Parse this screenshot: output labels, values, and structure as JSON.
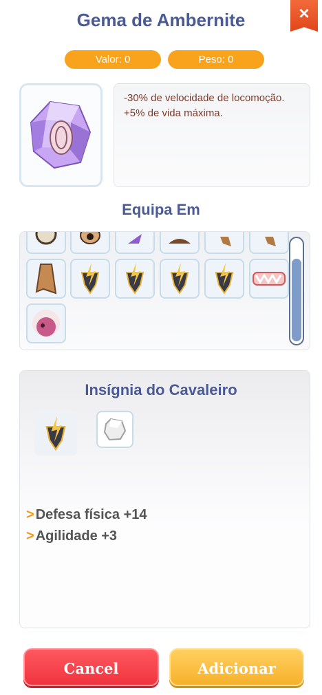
{
  "header": {
    "title": "Gema de Ambernite",
    "close_label": "×"
  },
  "stats": {
    "valor": "Valor: 0",
    "peso": "Peso: 0"
  },
  "item": {
    "icon": "amethyst-gem-icon",
    "description": "-30% de velocidade de locomoção. +5% de vida máxima."
  },
  "equipa": {
    "title": "Equipa Em",
    "items": [
      "helmet-icon",
      "mask-icon",
      "purple-boot-icon",
      "hair-icon",
      "cape-icon",
      "cape-icon",
      "cape-icon",
      "knight-insignia-icon",
      "knight-insignia-icon",
      "knight-insignia-icon",
      "knight-insignia-icon",
      "fang-mouth-icon",
      "fluffy-pet-icon"
    ]
  },
  "bonus": {
    "title": "Insígnia do Cavaleiro",
    "main_icon": "knight-insignia-icon",
    "gem_icon": "white-gem-icon",
    "lines": [
      "Defesa física +14",
      "Agilidade +3"
    ],
    "arrow": ">"
  },
  "buttons": {
    "cancel": "Cancel",
    "add": "Adicionar"
  }
}
